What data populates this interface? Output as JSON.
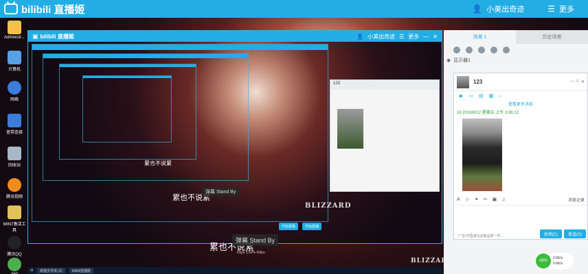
{
  "topbar": {
    "logo_text": "bilibili 直播姬",
    "user_name": "小美出奇迹",
    "more_label": "更多"
  },
  "desktop_icons": [
    {
      "label": "Administr...",
      "color": "#f6c04a"
    },
    {
      "label": "计算机",
      "color": "#5aa0e6"
    },
    {
      "label": "网络",
      "color": "#3b7dd8"
    },
    {
      "label": "宽带连接",
      "color": "#3b7dd8"
    },
    {
      "label": "回收站",
      "color": "#a8b8c8"
    },
    {
      "label": "腾讯视频",
      "color": "#f08c1e"
    },
    {
      "label": "WIN7激活工具",
      "color": "#e2c35a"
    },
    {
      "label": "腾讯QQ",
      "color": "#222"
    },
    {
      "label": "360",
      "color": "#4caf50"
    }
  ],
  "capture": {
    "window_title": "bilibili 直播姬",
    "user_name": "小美出奇迹",
    "more_label": "更多",
    "overlay_text_large": "累也不说累",
    "overlay_text_mid": "累也不说累",
    "overlay_text_small": "累也不说累",
    "danmu_label": "弹幕 Stand By",
    "danmu_label_small": "弹幕 Stand By",
    "start_live_btn": "开始直播",
    "settings_btn": "开始录像",
    "mini_name": "123",
    "stats": "Kbps  0.00%  60fps",
    "brand": "BLIZZARD"
  },
  "chat_panel": {
    "tab_active": "场景 1",
    "tab_inactive": "历史场景",
    "scene_item": "显示器1"
  },
  "chat_window": {
    "contact_name": "123",
    "history_link": "查看更多消息",
    "msg_time": "16 2016/8/12 星期五 上午 3:36:12",
    "history_label": "消息记录",
    "hint": "广告!中国成功运载遥感一号...",
    "close_btn": "关闭(C)",
    "send_btn": "发送(S)"
  },
  "network": {
    "percent": "49%",
    "up": "0.8K/s",
    "down": "0.6K/s"
  },
  "taskbar": {
    "items": [
      "新建文件夹 (2)",
      "bilibili直播姬"
    ]
  }
}
